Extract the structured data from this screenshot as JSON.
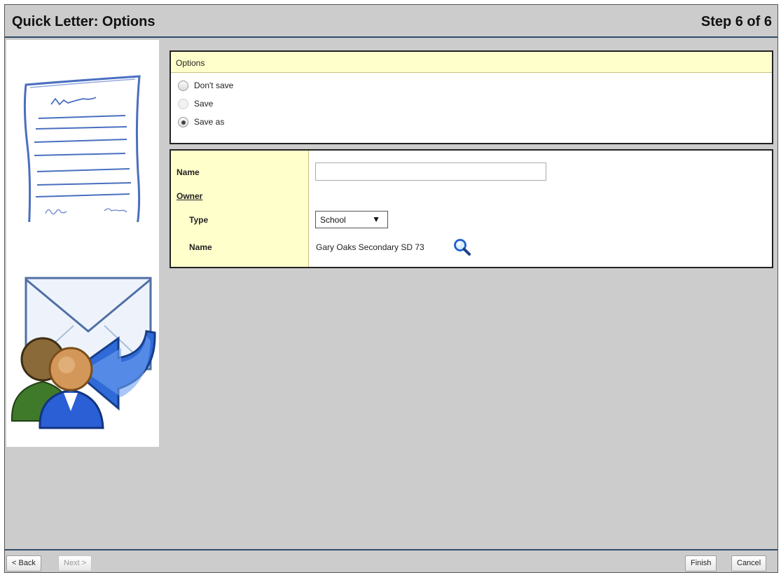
{
  "header": {
    "title": "Quick Letter: Options",
    "step": "Step 6 of 6"
  },
  "options": {
    "section_title": "Options",
    "radios": [
      {
        "label": "Don't save",
        "checked": false,
        "disabled": false
      },
      {
        "label": "Save",
        "checked": false,
        "disabled": true
      },
      {
        "label": "Save as",
        "checked": true,
        "disabled": false
      }
    ]
  },
  "form": {
    "name_label": "Name",
    "name_value": "",
    "owner_label": "Owner",
    "type_label": "Type",
    "type_value": "School",
    "owner_name_label": "Name",
    "owner_name_value": "Gary Oaks Secondary SD 73"
  },
  "footer": {
    "back_label": "< Back",
    "next_label": "Next >",
    "finish_label": "Finish",
    "cancel_label": "Cancel"
  },
  "icons": {
    "letter": "document-letter-icon",
    "mail": "mail-envelope-icon",
    "users": "users-icon",
    "search": "magnifier-search-icon",
    "dropdown": "dropdown-arrow-icon"
  }
}
